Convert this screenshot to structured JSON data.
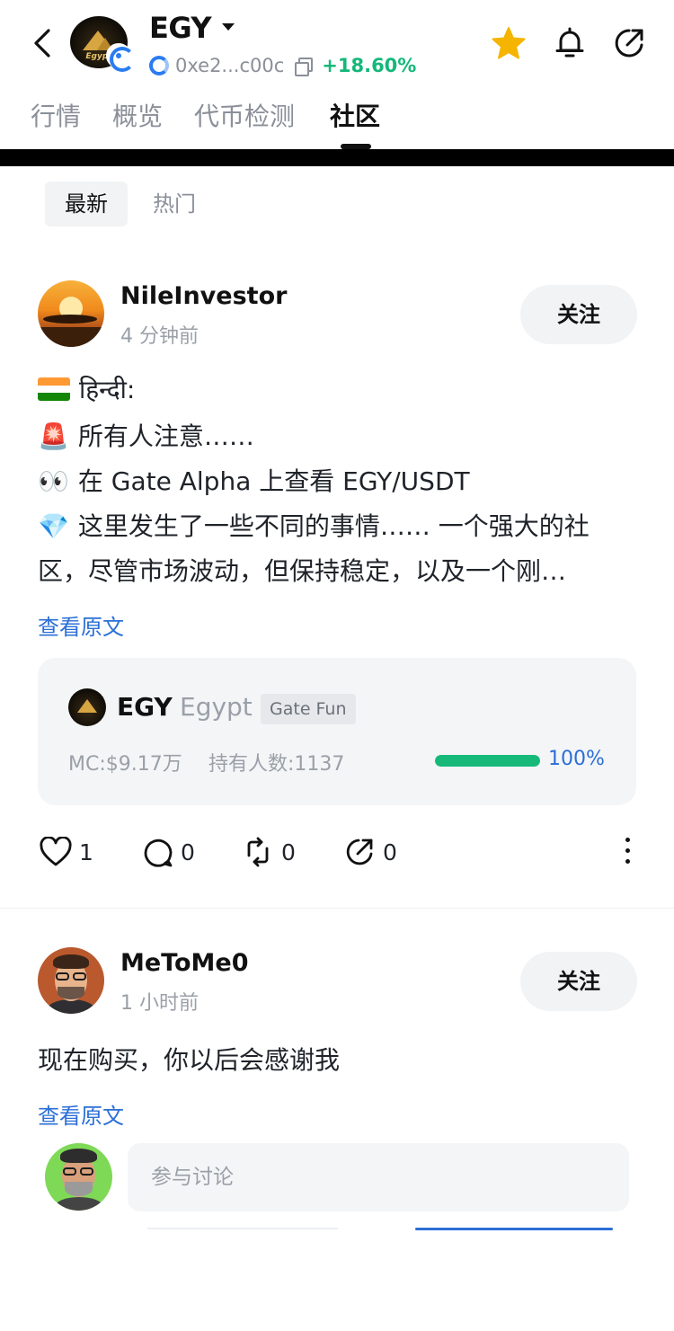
{
  "header": {
    "token_name": "EGY",
    "avatar_label": "Egypt",
    "address": "0xe2...c00c",
    "change": "+18.60%",
    "colors": {
      "accent_green": "#14b87a",
      "star": "#f5b400",
      "chain_blue": "#2a7cf0"
    }
  },
  "tabs": [
    {
      "label": "行情"
    },
    {
      "label": "概览"
    },
    {
      "label": "代币检测"
    },
    {
      "label": "社区",
      "active": true
    }
  ],
  "filters": {
    "latest": "最新",
    "hot": "热门"
  },
  "posts": [
    {
      "username": "NileInvestor",
      "time": "4 分钟前",
      "follow_label": "关注",
      "lines": [
        {
          "icon": "india-flag-icon",
          "text": "हिन्दी:"
        },
        {
          "icon": "siren-icon",
          "emoji": "🚨",
          "text": "所有人注意……"
        },
        {
          "icon": "eyes-icon",
          "emoji": "👀",
          "text": "在 Gate Alpha 上查看 EGY/USDT"
        },
        {
          "icon": "gem-icon",
          "emoji": "💎",
          "text": "这里发生了一些不同的事情…… 一个强大的社"
        },
        {
          "text": "区，尽管市场波动，但保持稳定，以及一个刚…"
        }
      ],
      "view_original": "查看原文",
      "token_card": {
        "symbol": "EGY",
        "name": "Egypt",
        "tag": "Gate Fun",
        "mc": "MC:$9.17万",
        "holders": "持有人数:1137",
        "progress": 100,
        "progress_label": "100%"
      },
      "actions": {
        "likes": "1",
        "comments": "0",
        "reposts": "0",
        "shares": "0"
      }
    },
    {
      "username": "MeToMe0",
      "time": "1 小时前",
      "follow_label": "关注",
      "text": "现在购买，你以后会感谢我",
      "view_original": "查看原文"
    }
  ],
  "comment_box": {
    "placeholder": "参与讨论"
  }
}
